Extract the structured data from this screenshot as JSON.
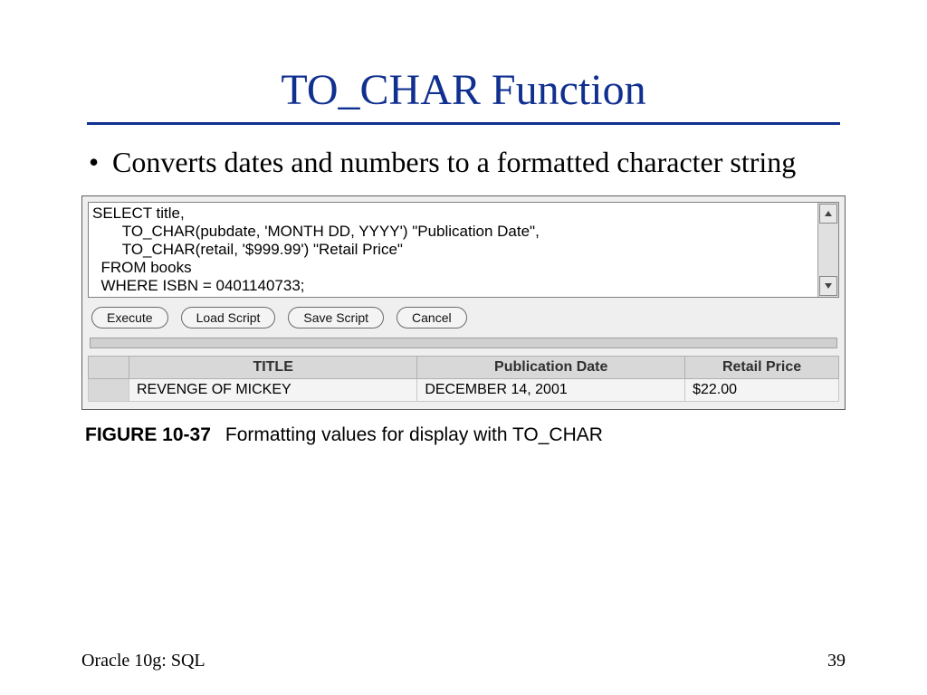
{
  "title": "TO_CHAR Function",
  "bullet": "Converts dates and numbers to a formatted character string",
  "sql": "SELECT title,\n       TO_CHAR(pubdate, 'MONTH DD, YYYY') \"Publication Date\",\n       TO_CHAR(retail, '$999.99') \"Retail Price\"\n  FROM books\n  WHERE ISBN = 0401140733;",
  "buttons": {
    "execute": "Execute",
    "load": "Load Script",
    "save": "Save Script",
    "cancel": "Cancel"
  },
  "table": {
    "headers": {
      "title": "TITLE",
      "pubdate": "Publication Date",
      "price": "Retail Price"
    },
    "row": {
      "title": "REVENGE OF MICKEY",
      "pubdate": "DECEMBER  14, 2001",
      "price": "$22.00"
    }
  },
  "caption": {
    "label": "FIGURE 10-37",
    "text": "Formatting values for display with TO_CHAR"
  },
  "footer": {
    "left": "Oracle 10g: SQL",
    "right": "39"
  }
}
